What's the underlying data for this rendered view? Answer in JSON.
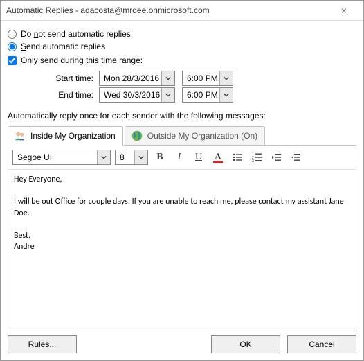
{
  "title": "Automatic Replies - adacosta@mrdee.onmicrosoft.com",
  "options": {
    "do_not_send": "Do not send automatic replies",
    "send": "Send automatic replies",
    "only_range": "Only send during this time range:",
    "start_label": "Start time:",
    "end_label": "End time:",
    "start_date": "Mon 28/3/2016",
    "start_time": "6:00 PM",
    "end_date": "Wed 30/3/2016",
    "end_time": "6:00 PM"
  },
  "section_label": "Automatically reply once for each sender with the following messages:",
  "tabs": {
    "inside": "Inside My Organization",
    "outside": "Outside My Organization (On)"
  },
  "toolbar": {
    "font_name": "Segoe UI",
    "font_size": "8"
  },
  "message": "Hey Everyone,\n\nI will be out Office for couple days. If you are unable to reach me, please contact my assistant Jane Doe.\n\nBest,\nAndre",
  "buttons": {
    "rules": "Rules...",
    "ok": "OK",
    "cancel": "Cancel"
  }
}
